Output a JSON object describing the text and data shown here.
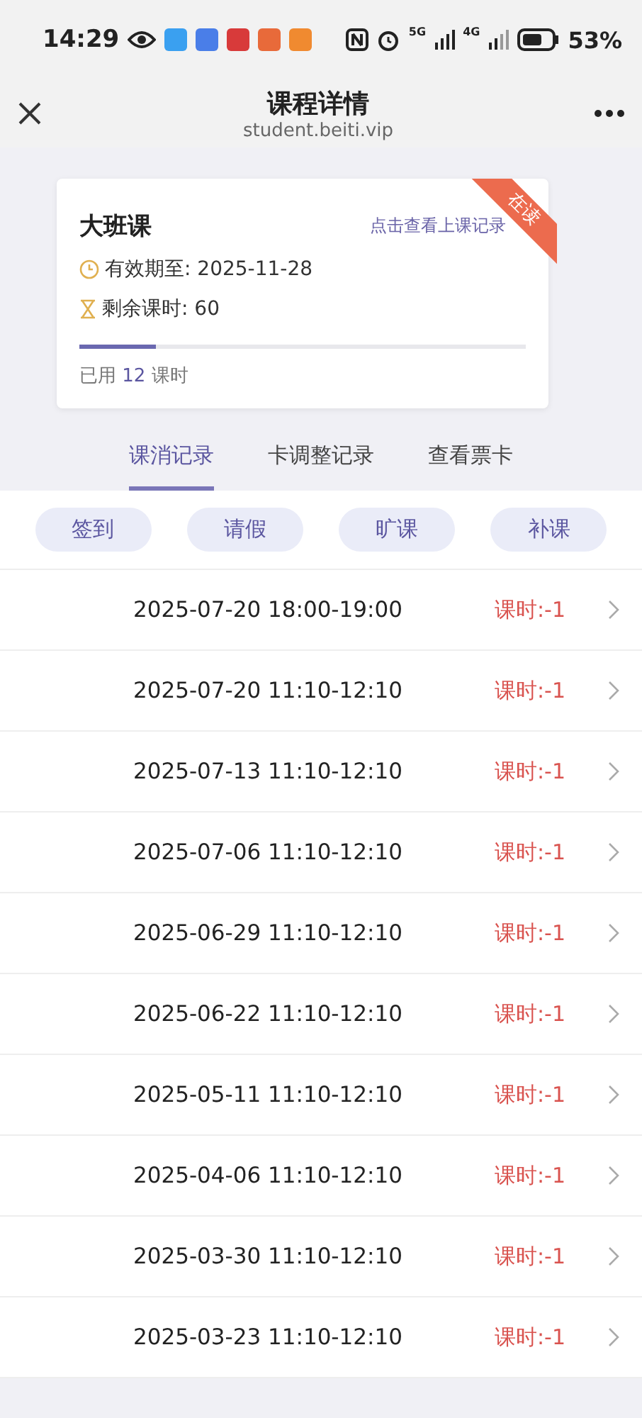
{
  "status_bar": {
    "time": "14:29",
    "network_1": "5G",
    "network_2": "4G",
    "battery": "53%"
  },
  "header": {
    "title": "课程详情",
    "subtitle": "student.beiti.vip"
  },
  "card": {
    "name": "大班课",
    "link": "点击查看上课记录",
    "ribbon": "在读",
    "expiry": "有效期至: 2025-11-28",
    "remaining": "剩余课时: 60",
    "level": 0.17,
    "used_prefix": "已用",
    "used_count": "12",
    "used_suffix": "课时"
  },
  "tabs": [
    {
      "label": "课消记录",
      "selected": true
    },
    {
      "label": "卡调整记录",
      "selected": false
    },
    {
      "label": "查看票卡",
      "selected": false
    }
  ],
  "filters": [
    "签到",
    "请假",
    "旷课",
    "补课"
  ],
  "records": [
    {
      "time": "2025-07-20 18:00-19:00",
      "hours": "课时:-1"
    },
    {
      "time": "2025-07-20 11:10-12:10",
      "hours": "课时:-1"
    },
    {
      "time": "2025-07-13 11:10-12:10",
      "hours": "课时:-1"
    },
    {
      "time": "2025-07-06 11:10-12:10",
      "hours": "课时:-1"
    },
    {
      "time": "2025-06-29 11:10-12:10",
      "hours": "课时:-1"
    },
    {
      "time": "2025-06-22 11:10-12:10",
      "hours": "课时:-1"
    },
    {
      "time": "2025-05-11 11:10-12:10",
      "hours": "课时:-1"
    },
    {
      "time": "2025-04-06 11:10-12:10",
      "hours": "课时:-1"
    },
    {
      "time": "2025-03-30 11:10-12:10",
      "hours": "课时:-1"
    },
    {
      "time": "2025-03-23 11:10-12:10",
      "hours": "课时:-1"
    }
  ]
}
